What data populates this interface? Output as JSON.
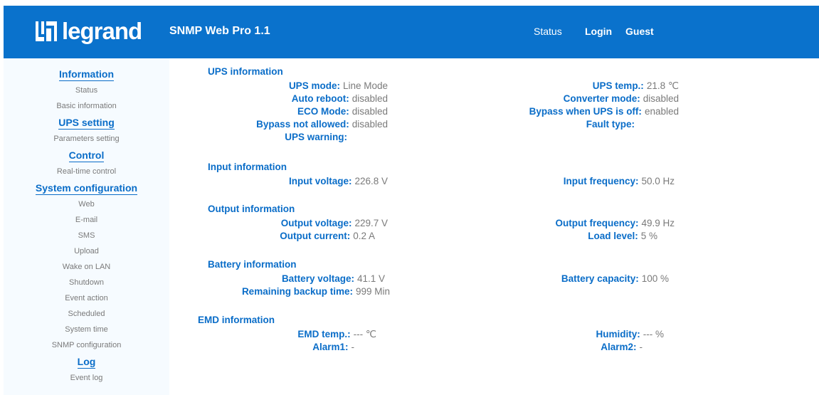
{
  "header": {
    "logo_text": "legrand",
    "product": "SNMP Web Pro 1.1",
    "nav_status": "Status",
    "nav_login": "Login",
    "nav_user": "Guest",
    "bg_color": "#0a72cc"
  },
  "sidebar": {
    "sections": [
      {
        "title": "Information",
        "items": [
          "Status",
          "Basic information"
        ]
      },
      {
        "title": "UPS setting",
        "items": [
          "Parameters setting"
        ]
      },
      {
        "title": "Control",
        "items": [
          "Real-time control"
        ]
      },
      {
        "title": "System configuration",
        "items": [
          "Web",
          "E-mail",
          "SMS",
          "Upload",
          "Wake on LAN",
          "Shutdown",
          "Event action",
          "Scheduled",
          "System time",
          "SNMP configuration"
        ]
      },
      {
        "title": "Log",
        "items": [
          "Event log"
        ]
      }
    ]
  },
  "sections": {
    "ups": {
      "title": "UPS information",
      "left": [
        {
          "label": "UPS mode:",
          "value": "Line Mode"
        },
        {
          "label": "Auto reboot:",
          "value": "disabled"
        },
        {
          "label": "ECO Mode:",
          "value": "disabled"
        },
        {
          "label": "Bypass not allowed:",
          "value": "disabled"
        },
        {
          "label": "UPS warning:",
          "value": ""
        }
      ],
      "right": [
        {
          "label": "UPS temp.:",
          "value": "21.8 ℃"
        },
        {
          "label": "Converter mode:",
          "value": "disabled"
        },
        {
          "label": "Bypass when UPS is off:",
          "value": "enabled"
        },
        {
          "label": "Fault type:",
          "value": ""
        }
      ]
    },
    "input": {
      "title": "Input information",
      "left": [
        {
          "label": "Input voltage:",
          "value": "226.8 V"
        }
      ],
      "right": [
        {
          "label": "Input frequency:",
          "value": "50.0 Hz"
        }
      ]
    },
    "output": {
      "title": "Output information",
      "left": [
        {
          "label": "Output voltage:",
          "value": "229.7 V"
        },
        {
          "label": "Output current:",
          "value": "0.2 A"
        }
      ],
      "right": [
        {
          "label": "Output frequency:",
          "value": "49.9 Hz"
        },
        {
          "label": "Load level:",
          "value": "5 %"
        }
      ]
    },
    "battery": {
      "title": "Battery information",
      "left": [
        {
          "label": "Battery voltage:",
          "value": "41.1 V"
        },
        {
          "label": "Remaining backup time:",
          "value": "999 Min"
        }
      ],
      "right": [
        {
          "label": "Battery capacity:",
          "value": "100 %"
        }
      ]
    },
    "emd": {
      "title": "EMD information",
      "left": [
        {
          "label": "EMD temp.:",
          "value": "--- ℃"
        },
        {
          "label": "Alarm1:",
          "value": "-"
        }
      ],
      "right": [
        {
          "label": "Humidity:",
          "value": "--- %"
        },
        {
          "label": "Alarm2:",
          "value": "-"
        }
      ]
    }
  }
}
